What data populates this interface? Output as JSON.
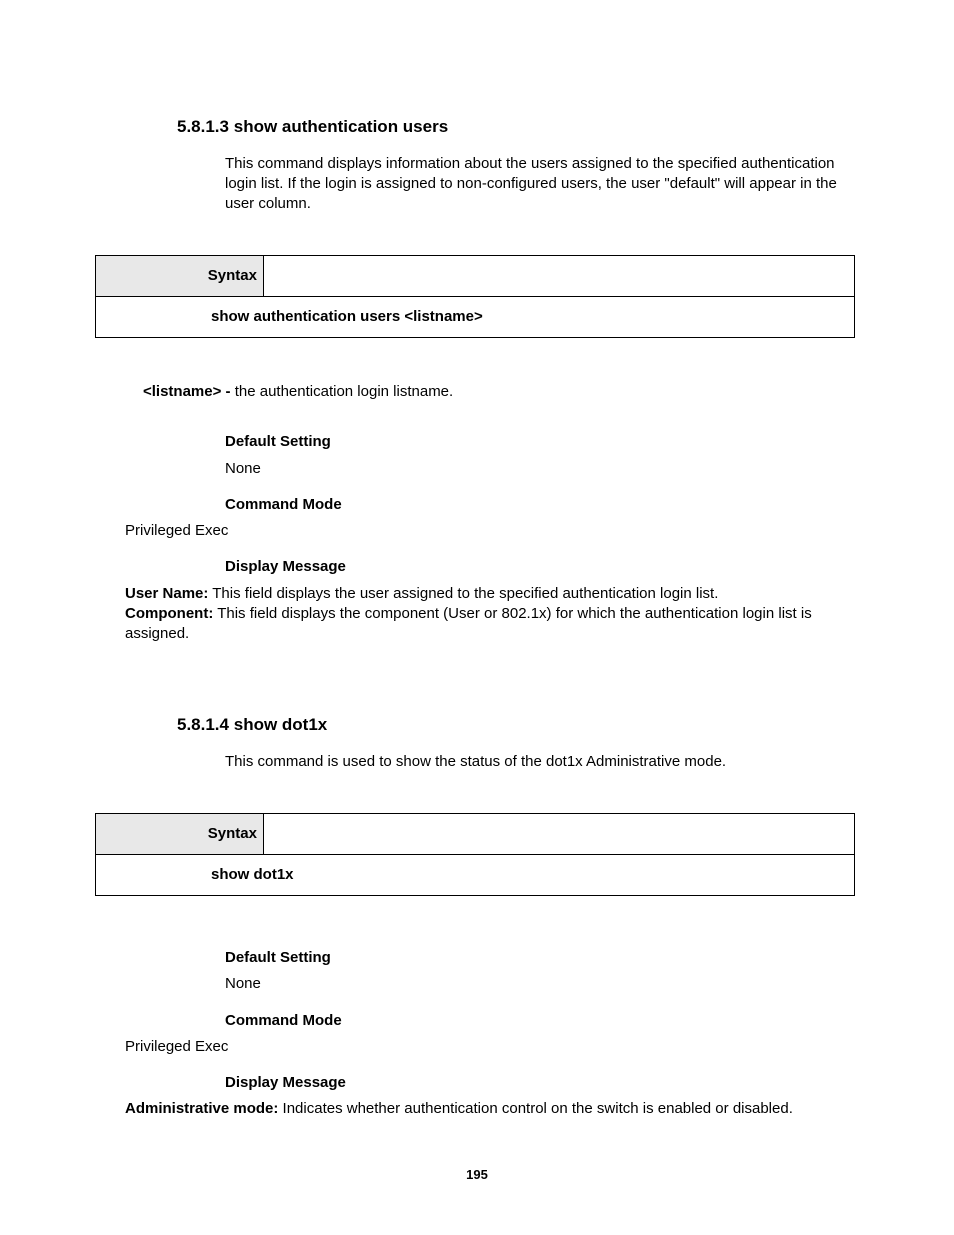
{
  "pageNumber": "195",
  "s1": {
    "num": "5.8.1.3",
    "title": "show authentication users",
    "desc": "This command displays information about the users assigned to the specified authentication login list. If the login is assigned to non-configured users, the user \"default\" will appear in the user column.",
    "syntaxLabel": "Syntax",
    "syntaxBody": "show authentication users <listname>",
    "paramName": "<listname> - ",
    "paramDesc": "the authentication login listname.",
    "defaultLabel": "Default Setting",
    "defaultVal": "None",
    "modeLabel": "Command Mode",
    "modeVal": "Privileged Exec",
    "dispLabel": "Display Message",
    "userLabel": "User Name:",
    "userDesc": " This field displays the user assigned to the specified authentication login list.",
    "compLabel": "Component:",
    "compDesc": " This field displays the component (User or 802.1x) for which the authentication login list is assigned."
  },
  "s2": {
    "num": "5.8.1.4",
    "title": "show dot1x",
    "desc": "This command is used to show the status of the dot1x Administrative mode.",
    "syntaxLabel": "Syntax",
    "syntaxBody": "show dot1x",
    "defaultLabel": "Default Setting",
    "defaultVal": "None",
    "modeLabel": "Command Mode",
    "modeVal": "Privileged Exec",
    "dispLabel": "Display Message",
    "adminLabel": "Administrative mode:",
    "adminDesc": " Indicates whether authentication control on the switch is enabled or disabled."
  }
}
